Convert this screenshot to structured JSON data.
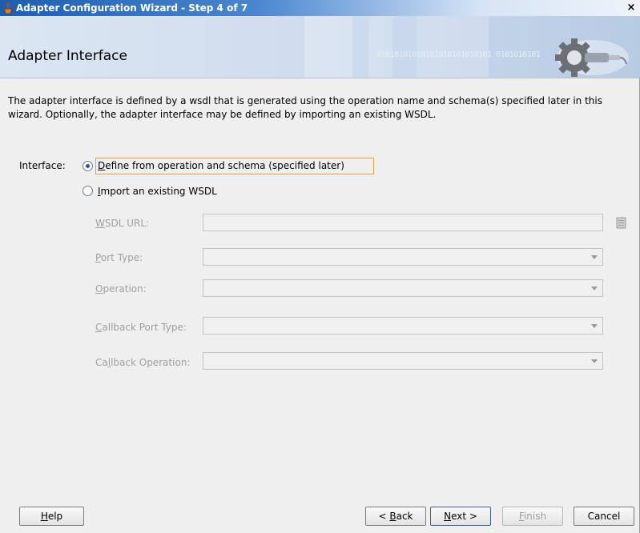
{
  "window": {
    "title": "Adapter Configuration Wizard - Step 4 of 7",
    "close_glyph": "×"
  },
  "banner": {
    "page_title": "Adapter Interface",
    "binary_text": "01010101010101010101010101 0101010101"
  },
  "description": "The adapter interface is defined by a wsdl that is generated using the operation name and schema(s) specified later in this wizard.  Optionally, the adapter interface may be defined by importing an existing WSDL.",
  "interface": {
    "label": "Interface:",
    "options": [
      {
        "label": "Define from operation and schema (specified later)",
        "mnemonic": "D",
        "rest": "efine from operation and schema (specified later)",
        "selected": true
      },
      {
        "label": "Import an existing WSDL",
        "mnemonic": "I",
        "rest": "mport an existing WSDL",
        "selected": false
      }
    ]
  },
  "fields": {
    "wsdl_url": {
      "mnemonic": "W",
      "rest": "SDL URL:",
      "value": ""
    },
    "port_type": {
      "mnemonic": "P",
      "rest": "ort Type:",
      "value": ""
    },
    "operation": {
      "mnemonic": "O",
      "rest": "peration:",
      "value": ""
    },
    "callback_port_type": {
      "mnemonic": "C",
      "rest": "allback Port Type:",
      "value": ""
    },
    "callback_operation": {
      "pre": "Ca",
      "mnemonic": "l",
      "rest": "lback Operation:",
      "value": ""
    }
  },
  "buttons": {
    "help": {
      "mnemonic": "H",
      "rest": "elp"
    },
    "back": {
      "pre": "< ",
      "mnemonic": "B",
      "rest": "ack"
    },
    "next": {
      "mnemonic": "N",
      "rest": "ext >"
    },
    "finish": {
      "mnemonic": "F",
      "rest": "inish"
    },
    "cancel": {
      "label": "Cancel"
    }
  },
  "icons": {
    "app": "java-cup-icon",
    "browse": "browse-folder-icon",
    "banner": "gear-plug-icon"
  },
  "colors": {
    "titlebar": "#1c5fb0",
    "focus": "#e8a23c",
    "radio_selected": "#2754a8"
  }
}
